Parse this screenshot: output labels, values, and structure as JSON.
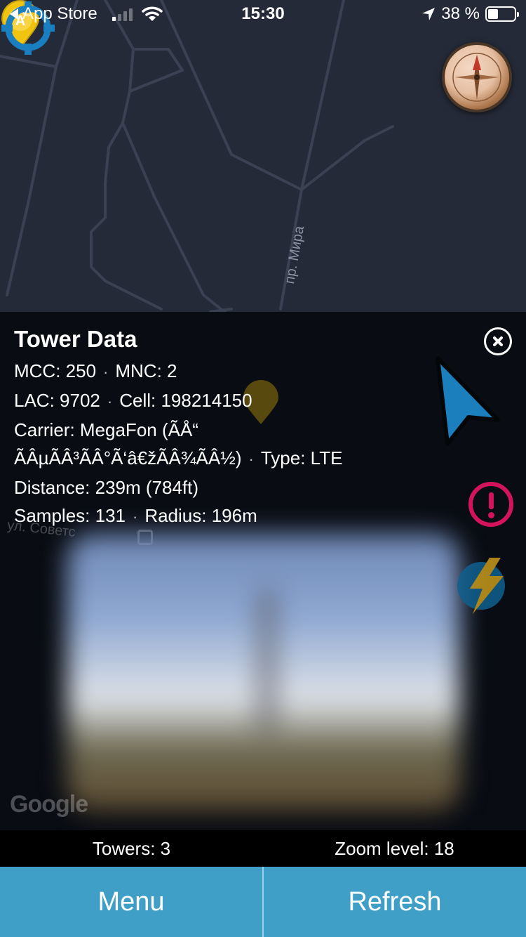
{
  "status_bar": {
    "back_label": "App Store",
    "time": "15:30",
    "battery_text": "38 %",
    "battery_level": 0.38
  },
  "map": {
    "street_label": "пр. Мира",
    "street_label_2": "ул. Советс",
    "attribution": "Google"
  },
  "tower_panel": {
    "title": "Tower Data",
    "mcc_label": "MCC: 250",
    "mnc_label": "MNC: 2",
    "lac_label": "LAC: 9702",
    "cell_label": "Cell: 198214150",
    "carrier_label": "Carrier: MegaFon (ÃÅ“",
    "carrier_label_cont": "ÃÂµÃÂ³ÃÂ°Ã‘â€žÃÂ¾ÃÂ½)",
    "type_label": "Type: LTE",
    "distance_label": "Distance: 239m (784ft)",
    "samples_label": "Samples: 131",
    "radius_label": "Radius: 196m",
    "separator": "·"
  },
  "stats": {
    "towers": "Towers: 3",
    "zoom": "Zoom level: 18"
  },
  "buttons": {
    "menu": "Menu",
    "refresh": "Refresh"
  },
  "colors": {
    "map_bg": "#242a38",
    "accent_blue": "#3f9fc6",
    "locate_blue": "#1a7fc0",
    "alert_pink": "#d4145a",
    "pin_yellow": "#f1c40f"
  }
}
